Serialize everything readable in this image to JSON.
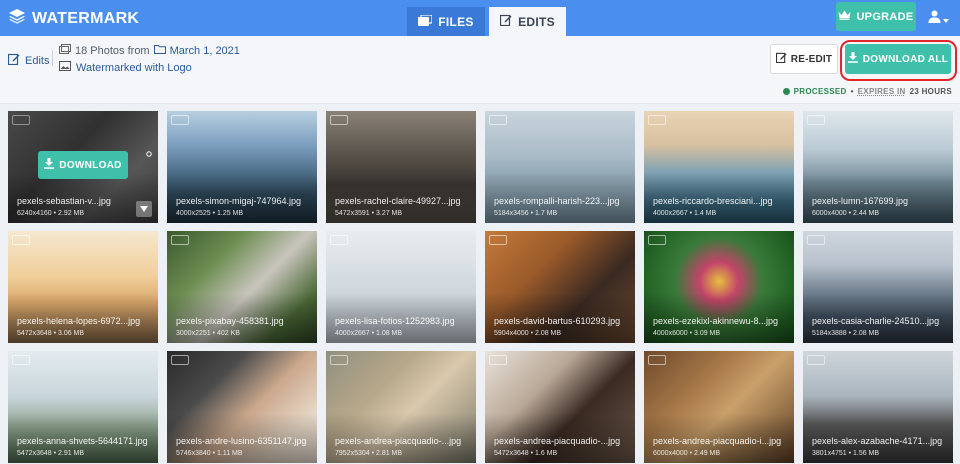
{
  "app": {
    "name": "WATERMARK",
    "logo_icon": "stack-layers-icon"
  },
  "tabs": [
    {
      "label": "FILES",
      "icon": "images-icon",
      "active": false
    },
    {
      "label": "EDITS",
      "icon": "edit-icon",
      "active": true
    }
  ],
  "header": {
    "upgrade_label": "UPGRADE",
    "upgrade_icon": "crown-icon",
    "user_icon": "user-icon"
  },
  "subheader": {
    "breadcrumb": "Edits",
    "photo_count": "18 Photos from",
    "date": "March 1, 2021",
    "edit_type": "Watermarked with Logo",
    "reedit_label": "RE-EDIT",
    "download_all_label": "DOWNLOAD ALL",
    "status_processed": "PROCESSED",
    "status_sep": "•",
    "status_expires": "EXPIRES IN",
    "status_expires_time": "23 HOURS"
  },
  "hover_download_label": "DOWNLOAD",
  "colors": {
    "topbar": "#4a8ff0",
    "accent": "#3fc0ab",
    "status_green": "#2b8a52",
    "highlight": "#e0262e"
  },
  "photos": [
    {
      "name": "pexels-sebastian-v...jpg",
      "meta": "6240x4160 • 2.92 MB",
      "hover": true,
      "bg": "linear-gradient(135deg,#5a5a5a 0%,#3c3c3c 40%,#6a6a6a 70%,#4a4a4a 100%)"
    },
    {
      "name": "pexels-simon-migaj-747964.jpg",
      "meta": "4000x2525 • 1.25 MB",
      "hover": false,
      "bg": "linear-gradient(180deg,#b8cfe0 0%,#7d9fbf 30%,#4d6e88 55%,#2e4a5c 75%,#1f3240 100%)"
    },
    {
      "name": "pexels-rachel-claire-49927...jpg",
      "meta": "5472x3591 • 3.27 MB",
      "hover": false,
      "bg": "linear-gradient(180deg,#8a8277 0%,#5e574f 35%,#3b3631 65%,#57514a 100%)"
    },
    {
      "name": "pexels-rompalli-harish-223...jpg",
      "meta": "5184x3456 • 1.7 MB",
      "hover": false,
      "bg": "linear-gradient(180deg,#c9d4dc 0%,#a8bbc7 40%,#8fa5b2 60%,#7893a3 100%)"
    },
    {
      "name": "pexels-riccardo-bresciani...jpg",
      "meta": "4000x2667 • 1.4 MB",
      "hover": false,
      "bg": "linear-gradient(180deg,#e8d3b4 0%,#d8c1a0 30%,#7fa2b3 55%,#3f6f86 80%,#28546a 100%)"
    },
    {
      "name": "pexels-lumn-167699.jpg",
      "meta": "6000x4000 • 2.44 MB",
      "hover": false,
      "bg": "linear-gradient(180deg,#dfe7ec 0%,#b9c9d3 35%,#6e8794 65%,#3d5561 100%)"
    },
    {
      "name": "pexels-helena-lopes-6972...jpg",
      "meta": "5472x3648 • 3.06 MB",
      "hover": false,
      "bg": "linear-gradient(180deg,#f5e7cf 0%,#f0cf9a 40%,#d9a76a 65%,#8a6a4b 100%)"
    },
    {
      "name": "pexels-pixabay-458381.jpg",
      "meta": "3000x2251 • 402 KB",
      "hover": false,
      "bg": "linear-gradient(135deg,#3b5a2f 0%,#6d8d52 30%,#c9c5bd 55%,#4c6a38 80%,#2e4424 100%)"
    },
    {
      "name": "pexels-lisa-fotios-1252983.jpg",
      "meta": "4000x2667 • 1.08 MB",
      "hover": false,
      "bg": "linear-gradient(180deg,#e8ecef 0%,#d6dde2 40%,#c7cfd6 70%,#b9c2ca 100%)"
    },
    {
      "name": "pexels-david-bartus-610293.jpg",
      "meta": "5904x4000 • 2.08 MB",
      "hover": false,
      "bg": "linear-gradient(135deg,#c47a3a 0%,#9a5a2a 35%,#3b2a22 65%,#6a4a30 100%)"
    },
    {
      "name": "pexels-ezekixl-akinnewu-8...jpg",
      "meta": "4000x6000 • 3.09 MB",
      "hover": false,
      "bg": "radial-gradient(circle at 50% 45%,#e6bf3e 0%,#c2446a 20%,#3a7a3a 45%,#236325 75%,#174a1a 100%)"
    },
    {
      "name": "pexels-casia-charlie-24510...jpg",
      "meta": "5184x3888 • 2.08 MB",
      "hover": false,
      "bg": "linear-gradient(180deg,#cfd6de 0%,#b7c0cb 30%,#6f7f8f 55%,#455464 75%,#2c3540 100%)"
    },
    {
      "name": "pexels-anna-shvets-5644171.jpg",
      "meta": "5472x3648 • 2.91 MB",
      "hover": false,
      "bg": "linear-gradient(180deg,#e3ebef 0%,#c9d6dc 40%,#8aa18a 70%,#4f6a4f 100%)"
    },
    {
      "name": "pexels-andre-lusino-6351147.jpg",
      "meta": "5746x3840 • 1.11 MB",
      "hover": false,
      "bg": "linear-gradient(135deg,#2a2a2a 0%,#4a4a4a 30%,#caa88c 55%,#e6d7c6 80%,#f0e6da 100%)"
    },
    {
      "name": "pexels-andrea-piacquadio-...jpg",
      "meta": "7952x5304 • 2.81 MB",
      "hover": false,
      "bg": "linear-gradient(135deg,#8f8f7f 0%,#b8a88a 35%,#d9c8ac 55%,#7a7a6a 100%)"
    },
    {
      "name": "pexels-andrea-piacquadio-...jpg",
      "meta": "5472x3648 • 1.6 MB",
      "hover": false,
      "bg": "linear-gradient(135deg,#e8e2da 0%,#b9a897 35%,#3a2a22 60%,#6d5a4a 100%)"
    },
    {
      "name": "pexels-andrea-piacquadio-i...jpg",
      "meta": "6000x4000 • 2.49 MB",
      "hover": false,
      "bg": "linear-gradient(135deg,#6d4a2a 0%,#a97a4a 35%,#caa06a 55%,#5a3e24 100%)"
    },
    {
      "name": "pexels-alex-azabache-4171...jpg",
      "meta": "3801x4751 • 1.56 MB",
      "hover": false,
      "bg": "linear-gradient(180deg,#cfd6dc 0%,#a9b4bd 40%,#5a5a5a 65%,#3a3a3a 100%)"
    }
  ]
}
